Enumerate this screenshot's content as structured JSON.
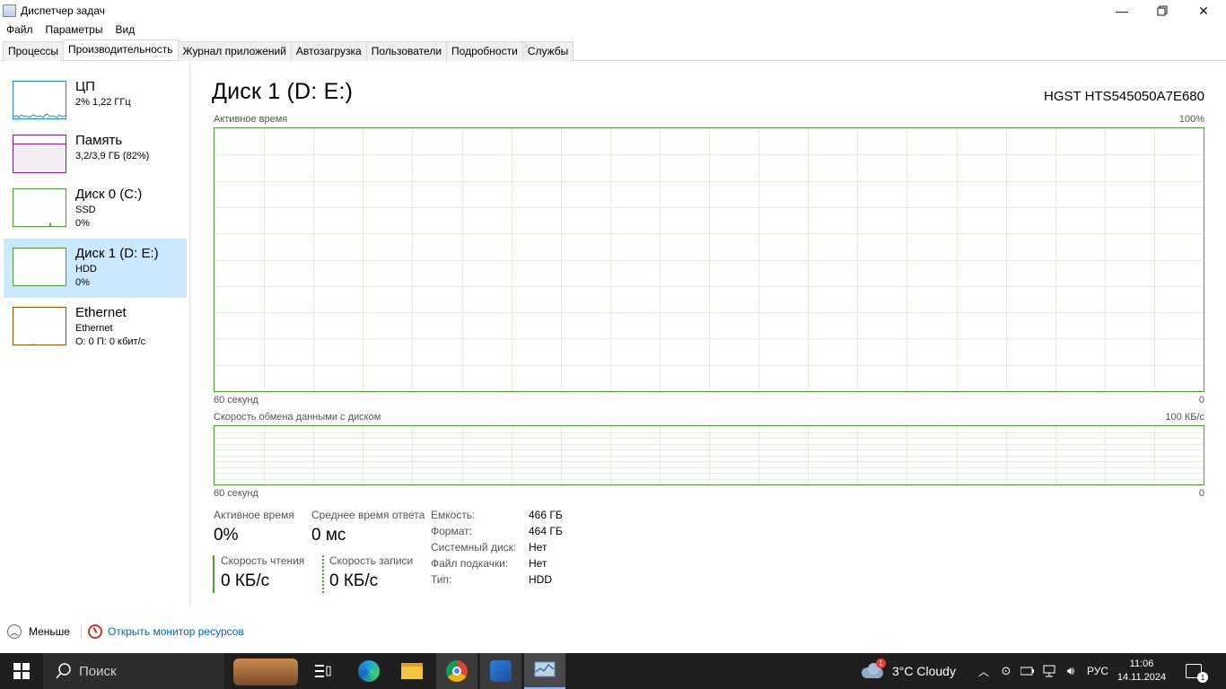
{
  "window": {
    "title": "Диспетчер задач"
  },
  "menu": [
    "Файл",
    "Параметры",
    "Вид"
  ],
  "tabs": [
    "Процессы",
    "Производительность",
    "Журнал приложений",
    "Автозагрузка",
    "Пользователи",
    "Подробности",
    "Службы"
  ],
  "active_tab": "Производительность",
  "devices": [
    {
      "name": "ЦП",
      "line1": "2% 1,22 ГГц",
      "line2": "",
      "color": "#1b8dc8",
      "usage_pct": 2
    },
    {
      "name": "Память",
      "line1": "3,2/3,9 ГБ (82%)",
      "line2": "",
      "color": "#8b1a9b",
      "usage_pct": 82
    },
    {
      "name": "Диск 0 (C:)",
      "line1": "SSD",
      "line2": "0%",
      "color": "#4aa02c",
      "usage_pct": 0
    },
    {
      "name": "Диск 1 (D: E:)",
      "line1": "HDD",
      "line2": "0%",
      "color": "#4aa02c",
      "usage_pct": 0
    },
    {
      "name": "Ethernet",
      "line1": "Ethernet",
      "line2": "О: 0 П: 0 кбит/с",
      "color": "#a74f01",
      "usage_pct": 0
    }
  ],
  "main": {
    "title": "Диск 1 (D: E:)",
    "model": "HGST HTS545050A7E680",
    "chart1": {
      "label": "Активное время",
      "max": "100%",
      "time": "60 секунд",
      "min": "0"
    },
    "chart2": {
      "label": "Скорость обмена данными с диском",
      "max": "100 КБ/с",
      "time": "60 секунд",
      "min": "0"
    },
    "stats": {
      "active_label": "Активное время",
      "active_value": "0%",
      "resp_label": "Среднее время ответа",
      "resp_value": "0 мс",
      "read_label": "Скорость чтения",
      "read_value": "0 КБ/с",
      "write_label": "Скорость записи",
      "write_value": "0 КБ/с"
    },
    "info": [
      {
        "key": "Емкость:",
        "value": "466 ГБ"
      },
      {
        "key": "Формат:",
        "value": "464 ГБ"
      },
      {
        "key": "Системный диск:",
        "value": "Нет"
      },
      {
        "key": "Файл подкачки:",
        "value": "Нет"
      },
      {
        "key": "Тип:",
        "value": "HDD"
      }
    ]
  },
  "bottom": {
    "less": "Меньше",
    "monitor": "Открыть монитор ресурсов"
  },
  "taskbar": {
    "search_placeholder": "Поиск",
    "weather": "3°C  Cloudy",
    "weather_badge": "1",
    "lang": "РУС",
    "time": "11:06",
    "date": "14.11.2024",
    "notif_count": "1"
  }
}
